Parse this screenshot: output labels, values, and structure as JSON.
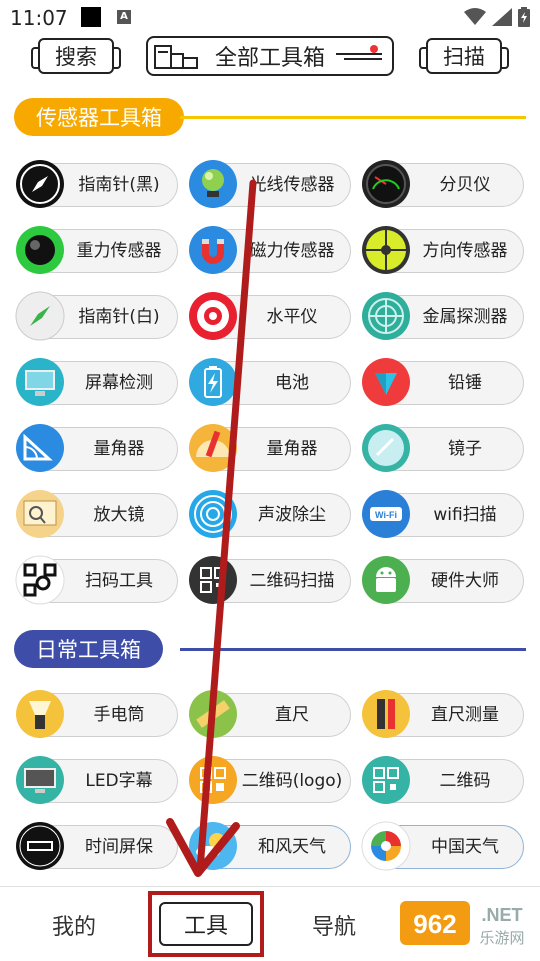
{
  "status": {
    "time": "11:07"
  },
  "topbar": {
    "search_label": "搜索",
    "title": "全部工具箱",
    "scan_label": "扫描"
  },
  "colors": {
    "sensor_accent": "#f7a900",
    "daily_accent": "#3e4ea8",
    "arrow": "#b01c1c"
  },
  "sections": [
    {
      "title": "传感器工具箱",
      "items": [
        {
          "label": "指南针(黑)",
          "icon": "compass-black-icon"
        },
        {
          "label": "光线传感器",
          "icon": "light-sensor-icon"
        },
        {
          "label": "分贝仪",
          "icon": "decibel-meter-icon"
        },
        {
          "label": "重力传感器",
          "icon": "gravity-ball-icon"
        },
        {
          "label": "磁力传感器",
          "icon": "magnet-icon"
        },
        {
          "label": "方向传感器",
          "icon": "direction-sensor-icon"
        },
        {
          "label": "指南针(白)",
          "icon": "compass-white-icon"
        },
        {
          "label": "水平仪",
          "icon": "level-target-icon"
        },
        {
          "label": "金属探测器",
          "icon": "metal-detector-icon"
        },
        {
          "label": "屏幕检测",
          "icon": "monitor-check-icon"
        },
        {
          "label": "电池",
          "icon": "battery-icon"
        },
        {
          "label": "铅锤",
          "icon": "plumb-bob-icon"
        },
        {
          "label": "量角器",
          "icon": "protractor-icon"
        },
        {
          "label": "量角器",
          "icon": "protractor-pencil-icon"
        },
        {
          "label": "镜子",
          "icon": "mirror-icon"
        },
        {
          "label": "放大镜",
          "icon": "magnifier-book-icon"
        },
        {
          "label": "声波除尘",
          "icon": "sound-wave-icon"
        },
        {
          "label": "wifi扫描",
          "icon": "wifi-icon"
        },
        {
          "label": "扫码工具",
          "icon": "qr-scan-icon"
        },
        {
          "label": "二维码扫描",
          "icon": "qr-code-icon"
        },
        {
          "label": "硬件大师",
          "icon": "android-icon"
        }
      ]
    },
    {
      "title": "日常工具箱",
      "items": [
        {
          "label": "手电筒",
          "icon": "flashlight-icon"
        },
        {
          "label": "直尺",
          "icon": "ruler-icon"
        },
        {
          "label": "直尺测量",
          "icon": "ruler-measure-icon"
        },
        {
          "label": "LED字幕",
          "icon": "led-monitor-icon"
        },
        {
          "label": "二维码(logo)",
          "icon": "qr-logo-icon"
        },
        {
          "label": "二维码",
          "icon": "qr-basic-icon"
        },
        {
          "label": "时间屏保",
          "icon": "clock-screensaver-icon"
        },
        {
          "label": "和风天气",
          "icon": "weather-sun-cloud-icon"
        },
        {
          "label": "中国天气",
          "icon": "china-weather-icon"
        }
      ]
    }
  ],
  "bottom_nav": {
    "mine": "我的",
    "tools": "工具",
    "nav": "导航"
  },
  "watermark": {
    "brand": "962",
    "net": ".NET",
    "site": "乐游网"
  }
}
